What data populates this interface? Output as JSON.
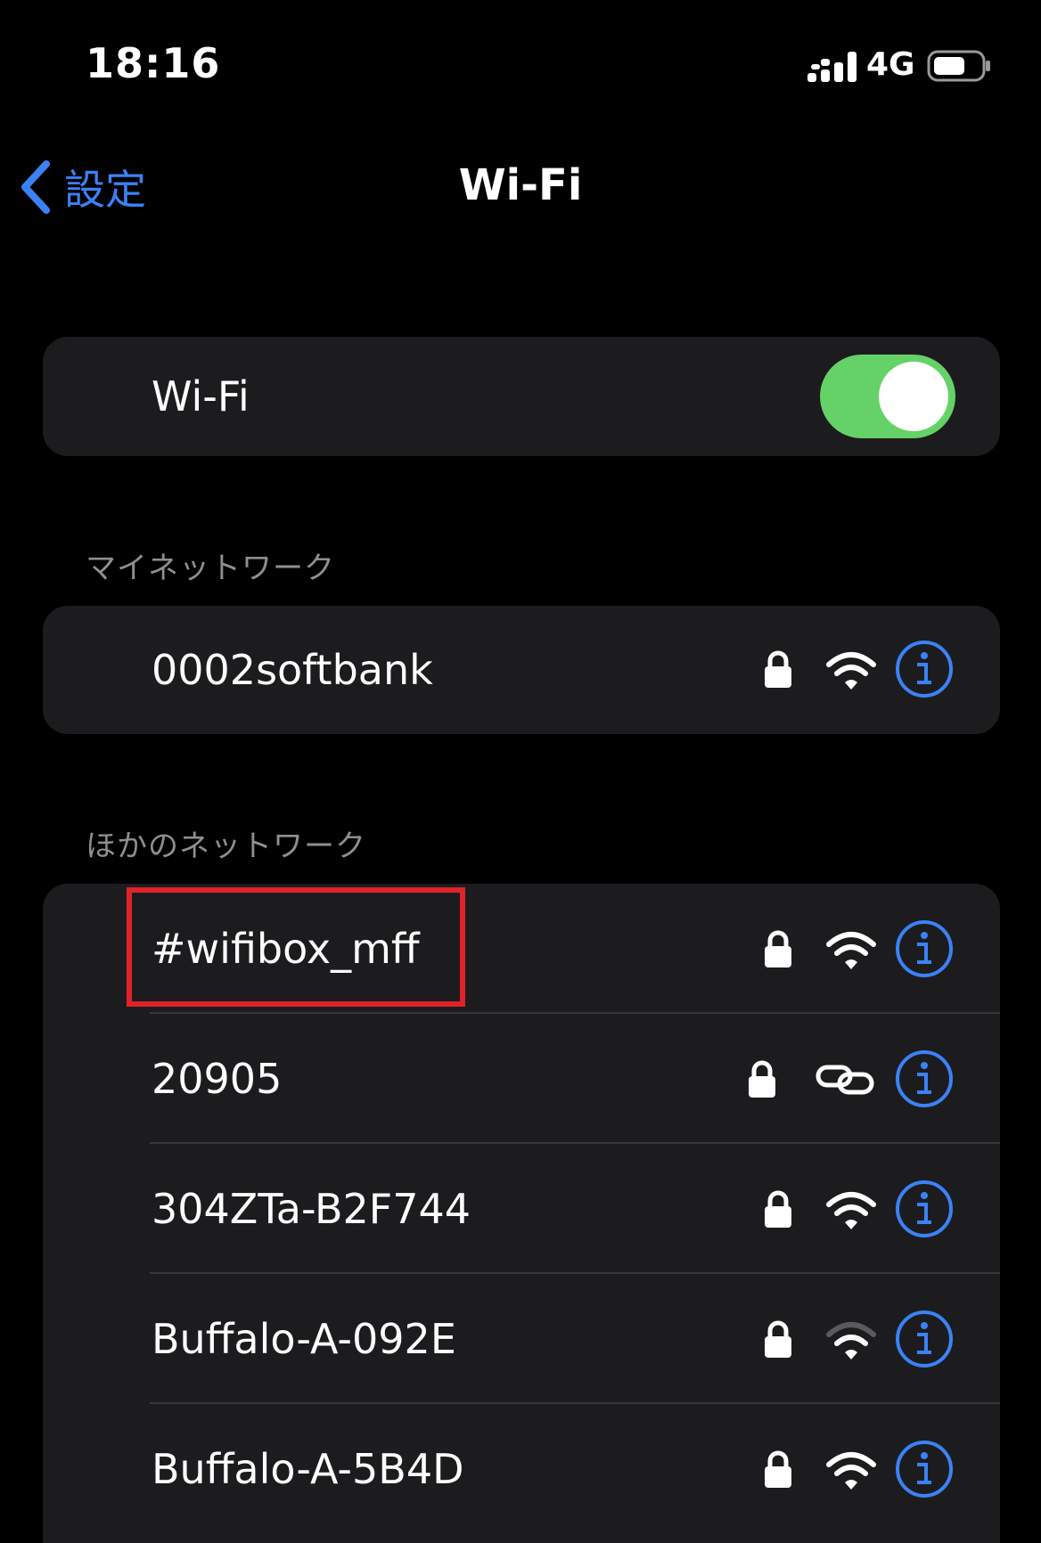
{
  "status_bar": {
    "time": "18:16",
    "network": "4G",
    "icons": [
      "cellular-signal-icon",
      "battery-icon"
    ]
  },
  "nav": {
    "back_label": "設定",
    "title": "Wi-Fi"
  },
  "wifi_toggle": {
    "label": "Wi-Fi",
    "on": true
  },
  "my_networks": {
    "header": "マイネットワーク",
    "items": [
      {
        "name": "0002softbank",
        "locked": true,
        "signal": "full"
      }
    ]
  },
  "other_networks": {
    "header": "ほかのネットワーク",
    "items": [
      {
        "name": "#wifibox_mff",
        "locked": true,
        "signal": "full"
      },
      {
        "name": "20905",
        "locked": true,
        "signal": "hotspot-link"
      },
      {
        "name": "304ZTa-B2F744",
        "locked": true,
        "signal": "full"
      },
      {
        "name": "Buffalo-A-092E",
        "locked": true,
        "signal": "medium"
      },
      {
        "name": "Buffalo-A-5B4D",
        "locked": true,
        "signal": "full"
      }
    ]
  },
  "colors": {
    "accent": "#3b82f6",
    "toggle_on": "#64d267",
    "highlight": "#e0222a",
    "cell_bg": "#1c1c1e"
  }
}
